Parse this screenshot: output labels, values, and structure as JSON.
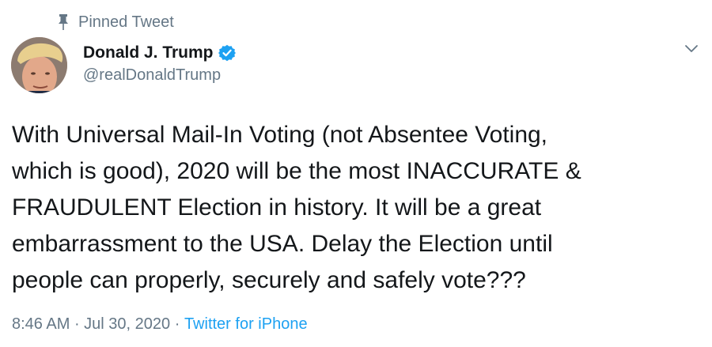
{
  "pinned": {
    "label": "Pinned Tweet",
    "icon": "pin-icon"
  },
  "author": {
    "display_name": "Donald J. Trump",
    "handle": "@realDonaldTrump",
    "verified": true,
    "verified_icon": "verified-badge-icon"
  },
  "tweet": {
    "text": "With Universal Mail-In Voting (not Absentee Voting,\nwhich is good), 2020 will be the most INACCURATE &\nFRAUDULENT Election in history. It will be a great\nembarrassment to the USA. Delay the Election until\npeople can properly, securely and safely vote???",
    "time": "8:46 AM",
    "separator": " · ",
    "date": "Jul 30, 2020",
    "source": "Twitter for iPhone"
  },
  "actions": {
    "menu_icon": "chevron-down-icon"
  },
  "colors": {
    "verified_blue": "#1da1f2",
    "secondary_text": "#657786",
    "primary_text": "#14171a"
  }
}
